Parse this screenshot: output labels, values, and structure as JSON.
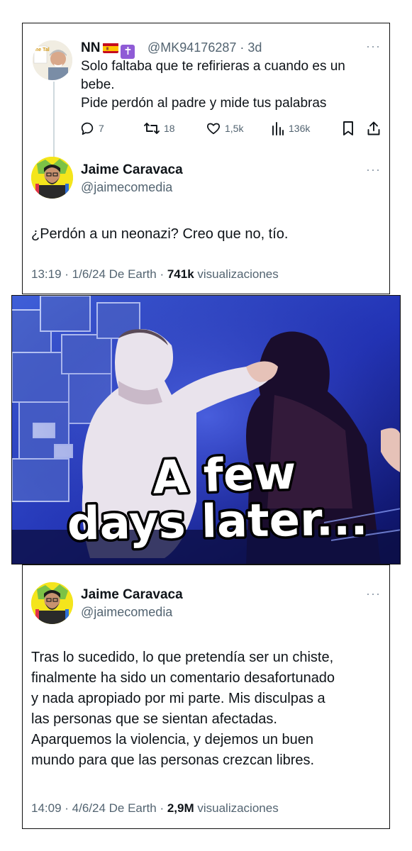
{
  "reply": {
    "name": "NN",
    "handle": "@MK94176287",
    "time": "3d",
    "lines": [
      "Solo faltaba que te refirieras a cuando es un",
      "bebe.",
      "Pide perdón al padre y mide tus palabras"
    ],
    "stats": {
      "replies": "7",
      "retweets": "18",
      "likes": "1,5k",
      "views": "136k"
    }
  },
  "tweet1": {
    "name": "Jaime Caravaca",
    "handle": "@jaimecomedia",
    "text": "¿Perdón a un neonazi? Creo que no, tío.",
    "meta_prefix": "13:19 · 1/6/24 De Earth · ",
    "views_count": "741k",
    "views_label": " visualizaciones"
  },
  "gif": {
    "caption_line1": "A few",
    "caption_line2": "days later..."
  },
  "tweet2": {
    "name": "Jaime Caravaca",
    "handle": "@jaimecomedia",
    "lines": [
      "Tras lo sucedido, lo que pretendía ser un chiste,",
      "finalmente ha sido un comentario desafortunado",
      "y nada apropiado por mi parte. Mis disculpas a",
      "las personas que se sientan afectadas.",
      "Aparquemos la violencia, y dejemos un buen",
      "mundo para que las personas crezcan libres."
    ],
    "meta_prefix": "14:09 · 4/6/24 De Earth · ",
    "views_count": "2,9M",
    "views_label": " visualizaciones"
  },
  "icons": [
    "more-icon",
    "reply-icon",
    "retweet-icon",
    "like-icon",
    "views-icon",
    "bookmark-icon",
    "share-icon",
    "spain-flag-icon",
    "cross-icon"
  ]
}
